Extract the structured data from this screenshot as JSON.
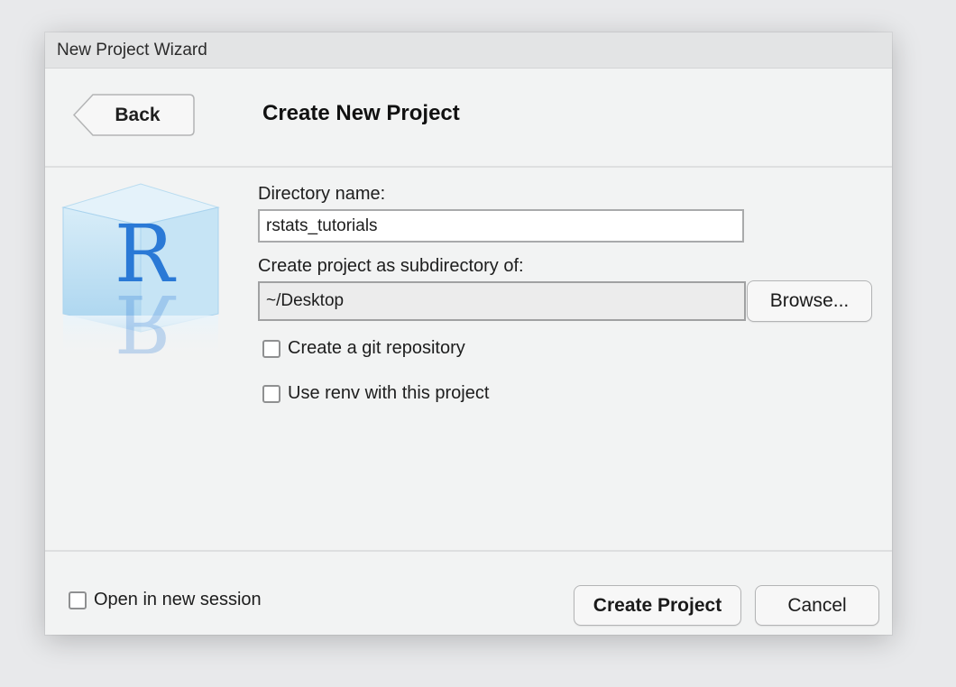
{
  "window": {
    "title": "New Project Wizard"
  },
  "header": {
    "back_label": "Back",
    "page_title": "Create New Project"
  },
  "form": {
    "directory_label": "Directory name:",
    "directory_value": "rstats_tutorials",
    "parent_label": "Create project as subdirectory of:",
    "parent_value": "~/Desktop",
    "browse_label": "Browse...",
    "git_label": "Create a git repository",
    "git_checked": false,
    "renv_label": "Use renv with this project",
    "renv_checked": false
  },
  "logo": {
    "letter": "R"
  },
  "footer": {
    "new_session_label": "Open in new session",
    "new_session_checked": false,
    "create_label": "Create Project",
    "cancel_label": "Cancel"
  },
  "colors": {
    "logo_blue": "#2a79d6",
    "logo_cube": "#bfe0f4",
    "dialog_bg": "#f2f3f3"
  }
}
